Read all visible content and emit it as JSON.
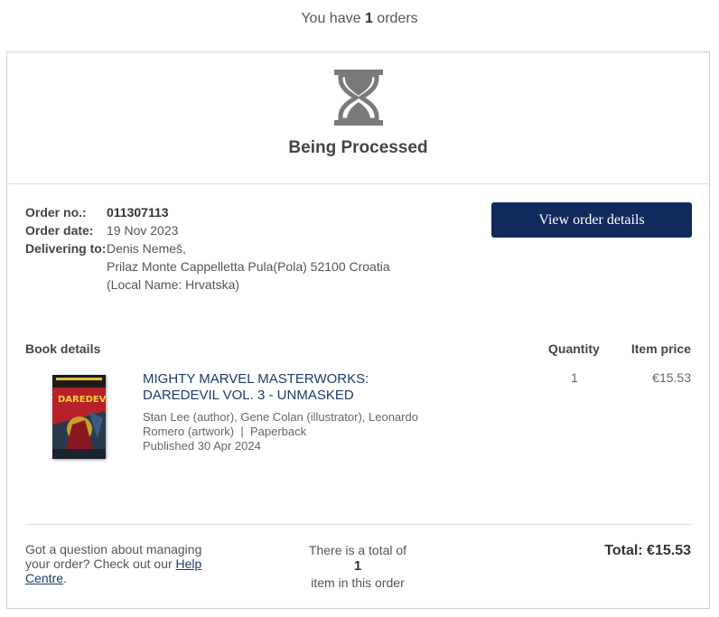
{
  "summary": {
    "prefix": "You have",
    "count": "1",
    "suffix": "orders"
  },
  "status": {
    "icon": "hourglass-icon",
    "label": "Being Processed",
    "icon_color": "#7a7a7a"
  },
  "order": {
    "number_label": "Order no.:",
    "number": "011307113",
    "date_label": "Order date:",
    "date": "19 Nov 2023",
    "delivering_label": "Delivering to:",
    "address_name": "Denis Nemeš,",
    "address_line": "Prilaz Monte Cappelletta Pula(Pola) 52100 Croatia",
    "address_local": "(Local Name: Hrvatska)"
  },
  "actions": {
    "view_details": "View order details"
  },
  "book_table": {
    "header_details": "Book details",
    "header_quantity": "Quantity",
    "header_price": "Item price",
    "items": [
      {
        "title": "MIGHTY MARVEL MASTERWORKS: DAREDEVIL VOL. 3 - UNMASKED",
        "contributors": "Stan Lee (author), Gene Colan (illustrator), Leonardo Romero (artwork)",
        "separator": "|",
        "format": "Paperback",
        "published": "Published 30 Apr 2024",
        "quantity": "1",
        "price": "€15.53",
        "cover_text": "DAREDEVIL"
      }
    ]
  },
  "footer": {
    "help_text": "Got a question about managing your order? Check out our",
    "help_link": "Help Centre",
    "help_end": ".",
    "total_prefix": "There is a total of",
    "total_count": "1",
    "total_suffix": "item in this order",
    "total_label": "Total: €15.53"
  },
  "colors": {
    "brand": "#102a5c",
    "link": "#1f3a68"
  }
}
